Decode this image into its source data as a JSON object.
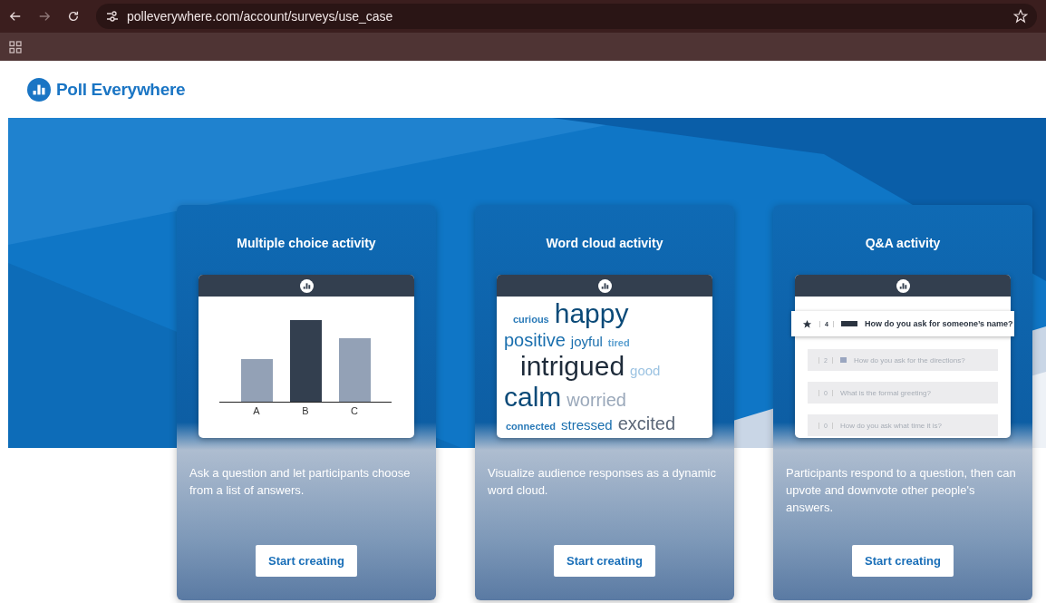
{
  "browser": {
    "url": "polleverywhere.com/account/surveys/use_case"
  },
  "logo": {
    "text": "Poll Everywhere"
  },
  "cards": [
    {
      "title": "Multiple choice activity",
      "kind": "bars",
      "bars": [
        {
          "label": "A",
          "selected": false
        },
        {
          "label": "B",
          "selected": true
        },
        {
          "label": "C",
          "selected": false
        }
      ],
      "description": "Ask a question and let participants choose from a list of answers.",
      "button": "Start creating"
    },
    {
      "title": "Word cloud activity",
      "kind": "cloud",
      "words": [
        {
          "text": "curious",
          "kind": "s",
          "color": "#2a7ab8"
        },
        {
          "text": "happy",
          "kind": "xl",
          "color": "#0b4a78"
        },
        {
          "text": "positive",
          "kind": "l",
          "color": "#1a6fae"
        },
        {
          "text": "joyful",
          "kind": "m",
          "color": "#1a6fae"
        },
        {
          "text": "tired",
          "kind": "s",
          "color": "#5a9fd0"
        },
        {
          "text": "intrigued",
          "kind": "xl",
          "color": "#1e2b3a"
        },
        {
          "text": "good",
          "kind": "m",
          "color": "#9cc3e2"
        },
        {
          "text": "calm",
          "kind": "xl",
          "color": "#0b4a78"
        },
        {
          "text": "worried",
          "kind": "l",
          "color": "#9aa8ba"
        },
        {
          "text": "connected",
          "kind": "s",
          "color": "#2a7ab8"
        },
        {
          "text": "stressed",
          "kind": "m",
          "color": "#1a6fae"
        },
        {
          "text": "excited",
          "kind": "l",
          "color": "#5b6778"
        }
      ],
      "description": "Visualize audience responses as a dynamic word cloud.",
      "button": "Start creating"
    },
    {
      "title": "Q&A activity",
      "kind": "qa",
      "questions": [
        {
          "votes": "4",
          "text": "How do you ask for someone’s name?",
          "selected": true
        },
        {
          "votes": "2",
          "text": "How do you ask for the directions?",
          "selected": false
        },
        {
          "votes": "0",
          "text": "What is the formal greeting?",
          "selected": false
        },
        {
          "votes": "0",
          "text": "How do you ask what time it is?",
          "selected": false
        }
      ],
      "description": "Participants respond to a question, then can upvote and downvote other people's answers.",
      "button": "Start creating"
    }
  ]
}
